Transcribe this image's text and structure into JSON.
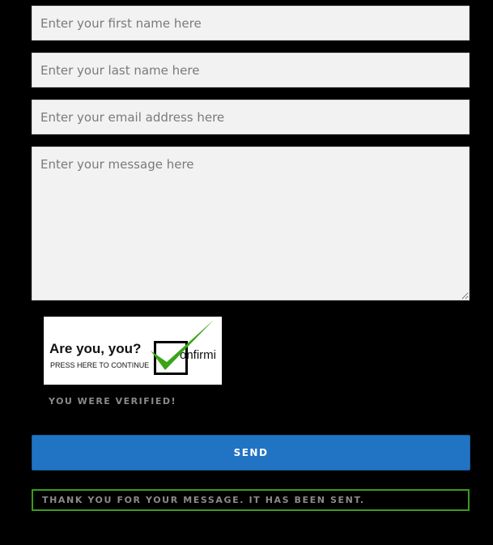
{
  "form": {
    "first_name": {
      "value": "",
      "placeholder": "Enter your first name here"
    },
    "last_name": {
      "value": "",
      "placeholder": "Enter your last name here"
    },
    "email": {
      "value": "",
      "placeholder": "Enter your email address here"
    },
    "message": {
      "value": "",
      "placeholder": "Enter your message here"
    }
  },
  "captcha": {
    "title": "Are you, you?",
    "subtitle": "PRESS HERE TO CONTINUE",
    "brand": "onfirmi",
    "check_color": "#3aa517"
  },
  "verified_text": "YOU WERE VERIFIED!",
  "send_label": "SEND",
  "notice_text": "THANK YOU FOR YOUR MESSAGE. IT HAS BEEN SENT.",
  "colors": {
    "button": "#2173c4",
    "notice_border": "#3d9a1c"
  }
}
